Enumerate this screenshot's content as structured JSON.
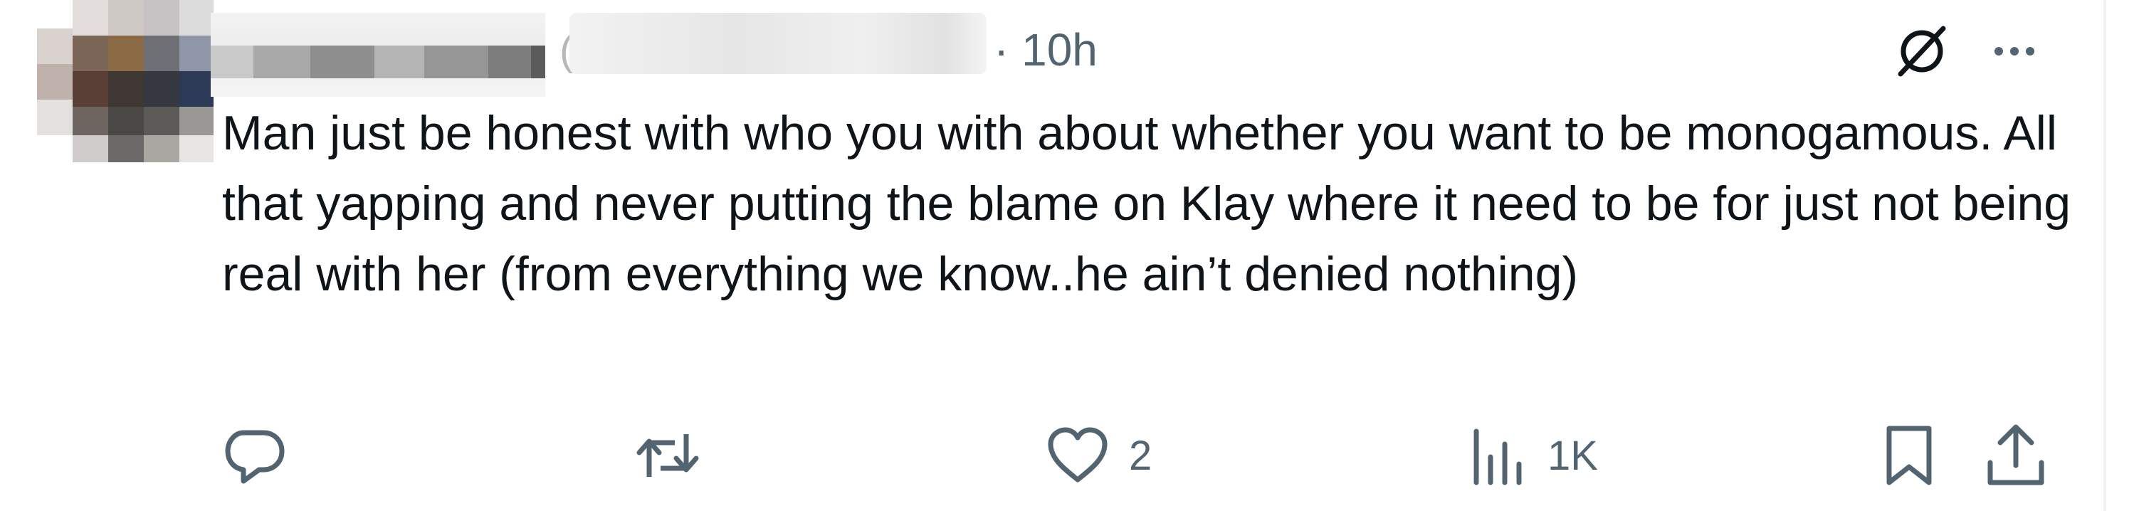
{
  "tweet": {
    "timestamp": "· 10h",
    "text": "Man just be honest with who you with about whether you want to be monogamous. All that yapping and never putting the blame on Klay where it need to be for just not being real with her (from everything we know..he ain’t denied nothing)",
    "icons": {
      "grok": "grok-slash-icon",
      "more": "more-dots-icon",
      "reply": "reply-bubble-icon",
      "repost": "repost-icon",
      "like": "heart-icon",
      "views": "views-bar-chart-icon",
      "bookmark": "bookmark-icon",
      "share": "share-upload-icon"
    },
    "stats": {
      "likes": "2",
      "views": "1K"
    }
  },
  "colors": {
    "text": "#0f1419",
    "secondary": "#536471",
    "background": "#ffffff"
  }
}
